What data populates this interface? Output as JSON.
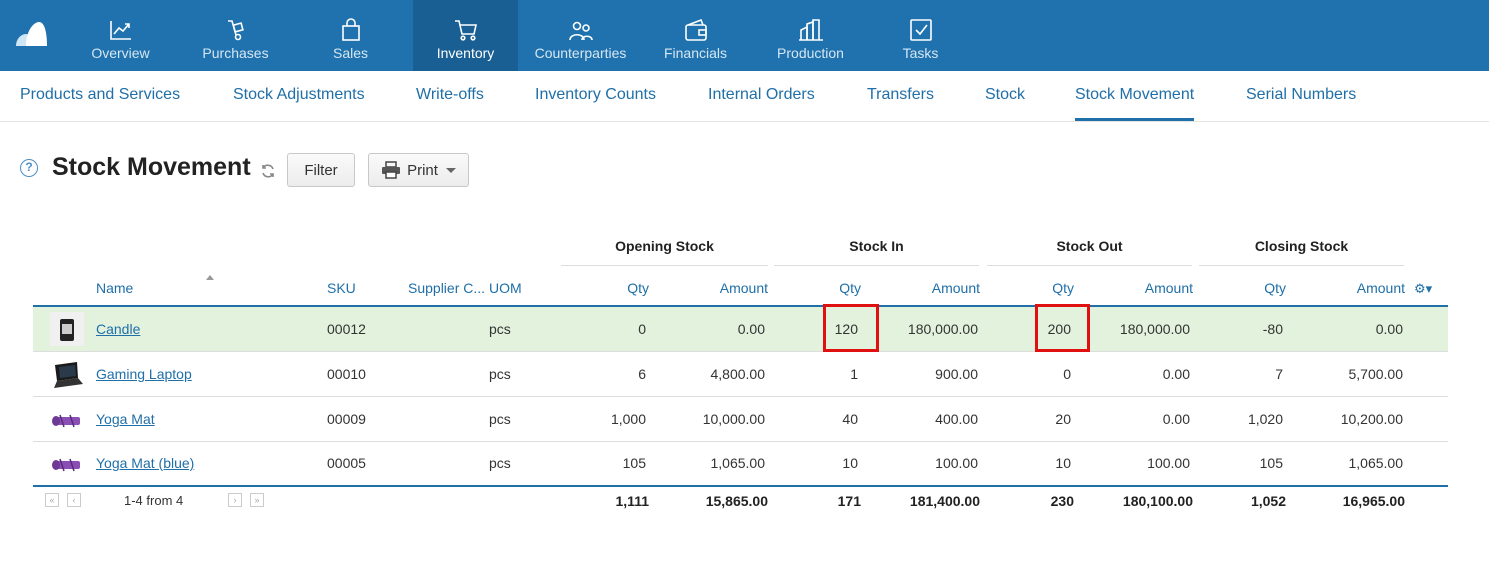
{
  "topnav": {
    "items": [
      {
        "label": "Overview",
        "icon": "chart-line-icon"
      },
      {
        "label": "Purchases",
        "icon": "hand-truck-icon"
      },
      {
        "label": "Sales",
        "icon": "shopping-bag-icon"
      },
      {
        "label": "Inventory",
        "icon": "cart-icon"
      },
      {
        "label": "Counterparties",
        "icon": "people-icon"
      },
      {
        "label": "Financials",
        "icon": "wallet-icon"
      },
      {
        "label": "Production",
        "icon": "factory-icon"
      },
      {
        "label": "Tasks",
        "icon": "checkbox-icon"
      }
    ],
    "active": "Inventory",
    "colors": {
      "bar": "#1f72ad",
      "active": "#195f93"
    }
  },
  "subnav": {
    "items": [
      "Products and Services",
      "Stock Adjustments",
      "Write-offs",
      "Inventory Counts",
      "Internal Orders",
      "Transfers",
      "Stock",
      "Stock Movement",
      "Serial Numbers"
    ],
    "active": "Stock Movement"
  },
  "page": {
    "title": "Stock Movement",
    "help": "?",
    "filter_label": "Filter",
    "print_label": "Print"
  },
  "table": {
    "groups": [
      "Opening Stock",
      "Stock In",
      "Stock Out",
      "Closing Stock"
    ],
    "columns": {
      "name": "Name",
      "sku": "SKU",
      "supplier": "Supplier C...",
      "uom": "UOM",
      "open_qty": "Qty",
      "open_amt": "Amount",
      "in_qty": "Qty",
      "in_amt": "Amount",
      "out_qty": "Qty",
      "out_amt": "Amount",
      "close_qty": "Qty",
      "close_amt": "Amount"
    },
    "rows": [
      {
        "name": "Candle",
        "sku": "00012",
        "uom": "pcs",
        "open_qty": "0",
        "open_amt": "0.00",
        "in_qty": "120",
        "in_amt": "180,000.00",
        "out_qty": "200",
        "out_amt": "180,000.00",
        "close_qty": "-80",
        "close_amt": "0.00",
        "thumb": "candle-icon"
      },
      {
        "name": "Gaming Laptop",
        "sku": "00010",
        "uom": "pcs",
        "open_qty": "6",
        "open_amt": "4,800.00",
        "in_qty": "1",
        "in_amt": "900.00",
        "out_qty": "0",
        "out_amt": "0.00",
        "close_qty": "7",
        "close_amt": "5,700.00",
        "thumb": "laptop-icon"
      },
      {
        "name": "Yoga Mat",
        "sku": "00009",
        "uom": "pcs",
        "open_qty": "1,000",
        "open_amt": "10,000.00",
        "in_qty": "40",
        "in_amt": "400.00",
        "out_qty": "20",
        "out_amt": "0.00",
        "close_qty": "1,020",
        "close_amt": "10,200.00",
        "thumb": "yoga-mat-icon"
      },
      {
        "name": "Yoga Mat (blue)",
        "sku": "00005",
        "uom": "pcs",
        "open_qty": "105",
        "open_amt": "1,065.00",
        "in_qty": "10",
        "in_amt": "100.00",
        "out_qty": "10",
        "out_amt": "100.00",
        "close_qty": "105",
        "close_amt": "1,065.00",
        "thumb": "yoga-mat-icon"
      }
    ],
    "totals": {
      "open_qty": "1,111",
      "open_amt": "15,865.00",
      "in_qty": "171",
      "in_amt": "181,400.00",
      "out_qty": "230",
      "out_amt": "180,100.00",
      "close_qty": "1,052",
      "close_amt": "16,965.00"
    },
    "pager": {
      "range": "1-4 from 4",
      "first": "«",
      "prev": "‹",
      "next": "›",
      "last": "»"
    },
    "selected_row_color": "#e2f2dd",
    "highlight_color": "#e01010"
  }
}
